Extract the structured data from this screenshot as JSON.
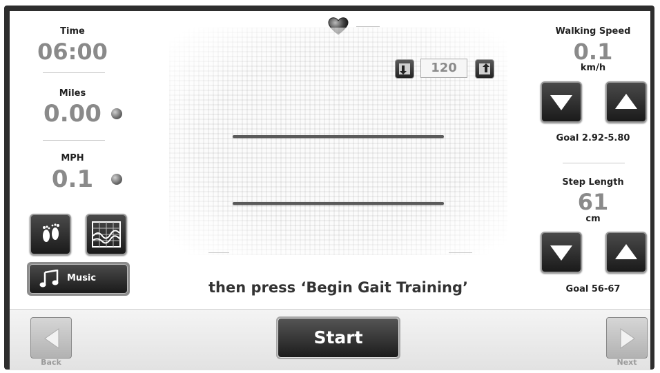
{
  "left": {
    "time_label": "Time",
    "time_value": "06:00",
    "miles_label": "Miles",
    "miles_value": "0.00",
    "mph_label": "MPH",
    "mph_value": "0.1",
    "music_label": "Music"
  },
  "center": {
    "cadence_value": "120",
    "instruction": "then press ‘Begin Gait Training’"
  },
  "right": {
    "walking_speed_label": "Walking Speed",
    "walking_speed_value": "0.1",
    "walking_speed_unit": "km/h",
    "walking_speed_goal": "Goal 2.92-5.80",
    "step_length_label": "Step Length",
    "step_length_value": "61",
    "step_length_unit": "cm",
    "step_length_goal": "Goal 56-67"
  },
  "bottom": {
    "start_label": "Start",
    "back_label": "Back",
    "next_label": "Next"
  },
  "icons": {
    "heart": "heart-icon",
    "feet": "footprints-icon",
    "graph": "graph-icon",
    "music": "music-note-icon"
  }
}
